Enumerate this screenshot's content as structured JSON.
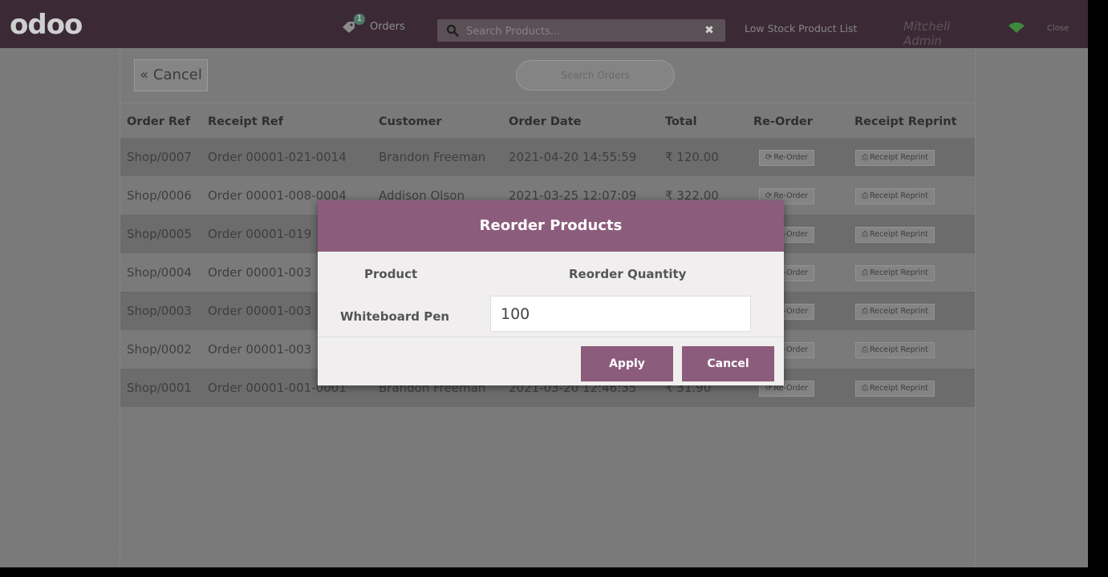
{
  "header": {
    "logo_text": "odoo",
    "orders_badge": "1",
    "orders_label": "Orders",
    "search_placeholder": "Search Products...",
    "low_stock_label": "Low Stock Product List",
    "user_name": "Mitchell Admin",
    "close_label": "Close"
  },
  "screen": {
    "cancel_label": "« Cancel",
    "search_orders_label": "Search Orders",
    "columns": [
      "Order Ref",
      "Receipt Ref",
      "Customer",
      "Order Date",
      "Total",
      "Re-Order",
      "Receipt Reprint"
    ],
    "reorder_btn": "Re-Order",
    "reprint_btn": "Receipt Reprint",
    "rows": [
      {
        "ref": "Shop/0007",
        "receipt": "Order 00001-021-0014",
        "customer": "Brandon Freeman",
        "date": "2021-04-20 14:55:59",
        "total": "₹ 120.00"
      },
      {
        "ref": "Shop/0006",
        "receipt": "Order 00001-008-0004",
        "customer": "Addison Olson",
        "date": "2021-03-25 12:07:09",
        "total": "₹ 322.00"
      },
      {
        "ref": "Shop/0005",
        "receipt": "Order 00001-019",
        "customer": "",
        "date": "",
        "total": ""
      },
      {
        "ref": "Shop/0004",
        "receipt": "Order 00001-003",
        "customer": "",
        "date": "",
        "total": ""
      },
      {
        "ref": "Shop/0003",
        "receipt": "Order 00001-003",
        "customer": "",
        "date": "",
        "total": ""
      },
      {
        "ref": "Shop/0002",
        "receipt": "Order 00001-003",
        "customer": "",
        "date": "",
        "total": ""
      },
      {
        "ref": "Shop/0001",
        "receipt": "Order 00001-001-0001",
        "customer": "Brandon Freeman",
        "date": "2021-03-20 12:46:35",
        "total": "₹ 31.90"
      }
    ]
  },
  "modal": {
    "title": "Reorder Products",
    "col_product": "Product",
    "col_quantity": "Reorder Quantity",
    "product_name": "Whiteboard Pen",
    "quantity_value": "100",
    "apply_label": "Apply",
    "cancel_label": "Cancel"
  },
  "colors": {
    "topbar": "#3b2a35",
    "overlay": "#7a7a7a",
    "modal_accent": "#8c5c7c",
    "modal_body": "#f0eeef"
  }
}
